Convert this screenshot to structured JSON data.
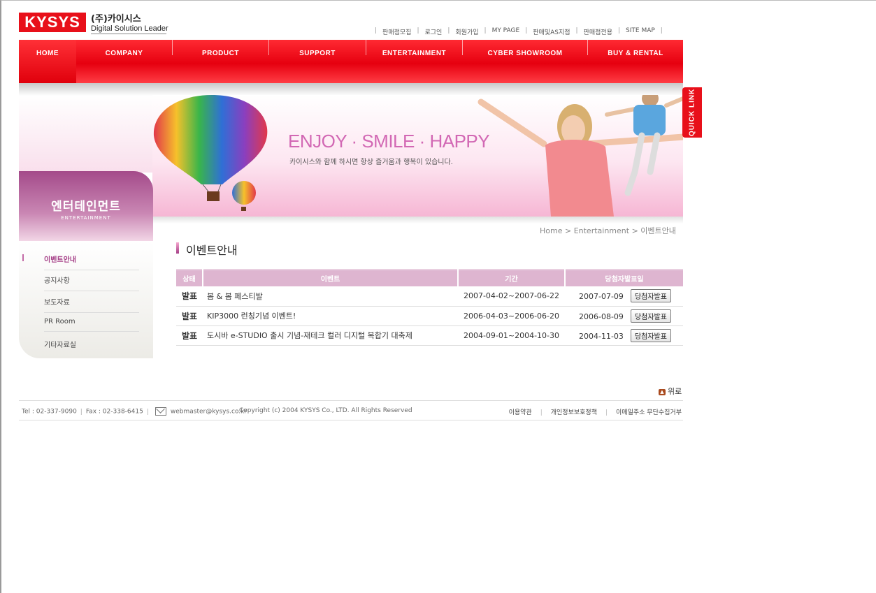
{
  "logo": {
    "brand": "KYSYS",
    "company_ko": "(주)카이시스",
    "tagline": "Digital Solution Leader"
  },
  "util_links": [
    "판매점모집",
    "로그인",
    "회원가입",
    "MY PAGE",
    "판매및AS지점",
    "판매점전용",
    "SITE MAP"
  ],
  "nav": [
    "HOME",
    "COMPANY",
    "PRODUCT",
    "SUPPORT",
    "ENTERTAINMENT",
    "CYBER SHOWROOM",
    "BUY & RENTAL"
  ],
  "banner": {
    "headline": "ENJOY · SMILE · HAPPY",
    "subtext": "카이시스와 함께 하시면 항상 즐거움과 행복이 있습니다."
  },
  "quick_link": "QUICK LINK",
  "left_panel": {
    "title_ko": "엔터테인먼트",
    "title_en": "ENTERTAINMENT",
    "menu": [
      "이벤트안내",
      "공지사항",
      "보도자료",
      "PR Room",
      "기타자료실"
    ]
  },
  "breadcrumb": "Home > Entertainment > 이벤트안내",
  "page_title": "이벤트안내",
  "table": {
    "headers": [
      "상태",
      "이벤트",
      "기간",
      "당첨자발표일"
    ],
    "rows": [
      {
        "status": "발표",
        "event": "봄 & 봄 페스티발",
        "period": "2007-04-02~2007-06-22",
        "date": "2007-07-09",
        "button": "당첨자발표"
      },
      {
        "status": "발표",
        "event": "KIP3000 런칭기념 이벤트!",
        "period": "2006-04-03~2006-06-20",
        "date": "2006-08-09",
        "button": "당첨자발표"
      },
      {
        "status": "발표",
        "event": "도시바 e-STUDIO 출시 기념-재테크 컬러 디지털 복합기 대축제",
        "period": "2004-09-01~2004-10-30",
        "date": "2004-11-03",
        "button": "당첨자발표"
      }
    ]
  },
  "top_link": "위로",
  "footer": {
    "tel": "Tel : 02-337-9090",
    "fax": "Fax : 02-338-6415",
    "email": "webmaster@kysys.co.kr",
    "copyright": "Copyright (c) 2004 KYSYS Co., LTD.  All Rights Reserved",
    "links": [
      "이용약관",
      "개인정보보호정책",
      "이메일주소 무단수집거부"
    ]
  },
  "colors": {
    "brand_red": "#e8101a",
    "accent_purple": "#a43d86",
    "table_header": "#deb5d0"
  }
}
